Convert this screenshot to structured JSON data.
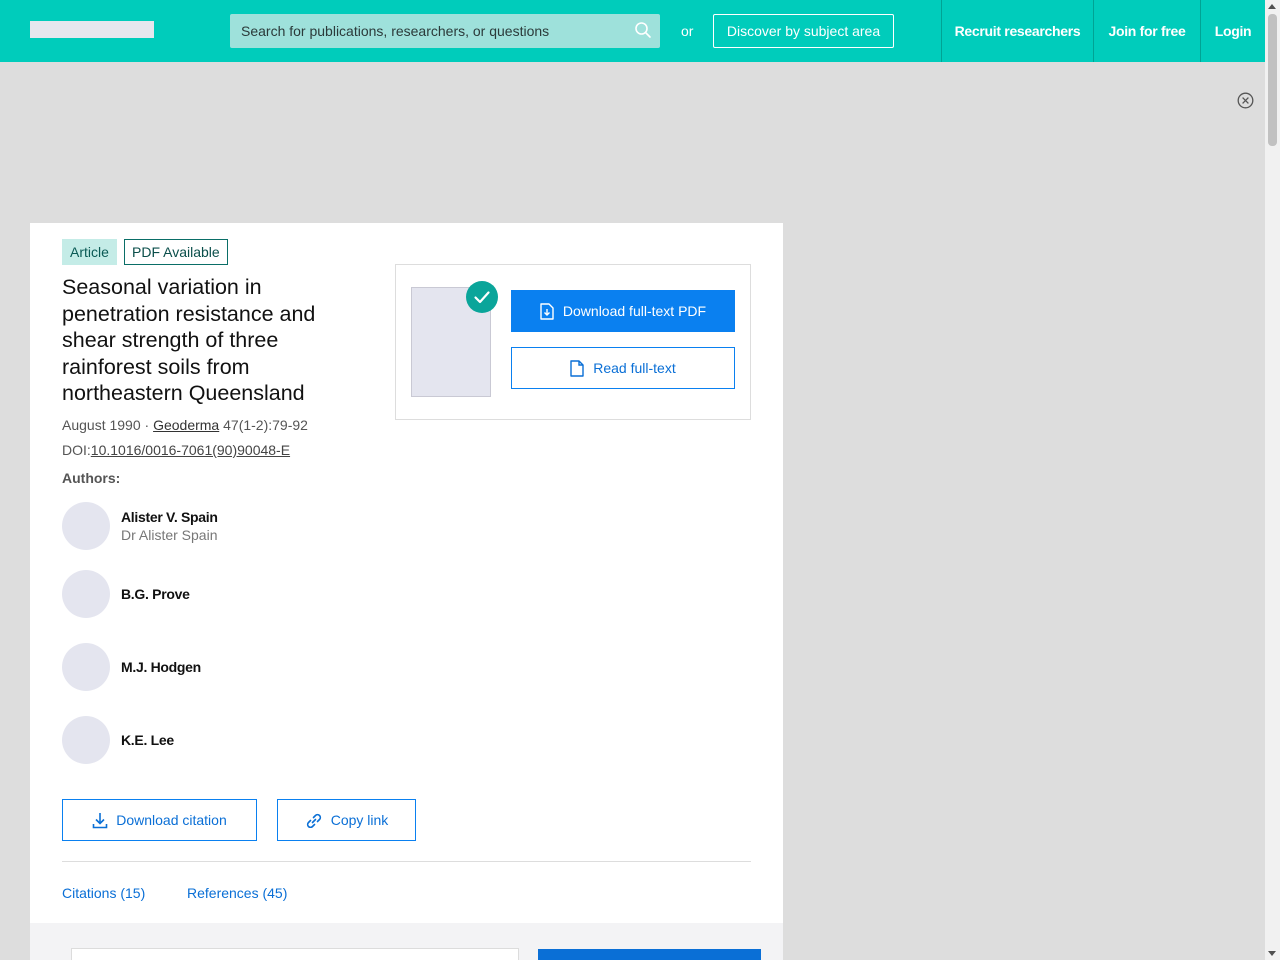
{
  "header": {
    "search_placeholder": "Search for publications, researchers, or questions",
    "or_label": "or",
    "discover_label": "Discover by subject area",
    "nav": {
      "recruit": "Recruit researchers",
      "join": "Join for free",
      "login": "Login"
    }
  },
  "article": {
    "type_badge": "Article",
    "pdf_badge": "PDF Available",
    "title": "Seasonal variation in penetration resistance and shear strength of three rainforest soils from northeastern Queensland",
    "date": "August 1990",
    "separator": " · ",
    "journal": "Geoderma",
    "volume_pages": " 47(1-2):79-92",
    "doi_label": "DOI:",
    "doi": "10.1016/0016-7061(90)90048-E",
    "authors_label": "Authors:",
    "authors": [
      {
        "name": "Alister V. Spain",
        "subtitle": "Dr Alister Spain"
      },
      {
        "name": "B.G. Prove"
      },
      {
        "name": "M.J. Hodgen"
      },
      {
        "name": "K.E. Lee"
      }
    ]
  },
  "actions": {
    "download_pdf": "Download full-text PDF",
    "read_fulltext": "Read full-text",
    "download_citation": "Download citation",
    "copy_link": "Copy link"
  },
  "tabs": {
    "citations": "Citations (15)",
    "references": "References (45)"
  },
  "colors": {
    "header_bg": "#00ccbb",
    "primary_blue": "#0a80f0",
    "check_teal": "#0aa59a"
  }
}
